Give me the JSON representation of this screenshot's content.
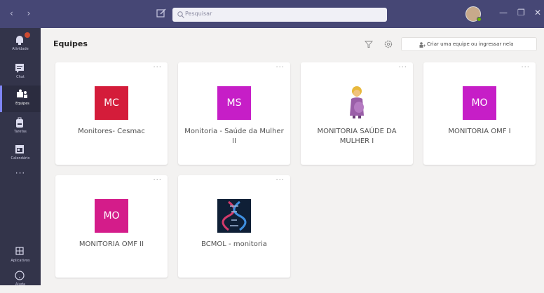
{
  "titlebar": {
    "search_placeholder": "Pesquisar",
    "nav_arrows": "‹ ›",
    "minimize": "—",
    "maximize": "❐",
    "close": "✕"
  },
  "rail": {
    "items": [
      {
        "label": "Atividade",
        "icon": "bell-icon"
      },
      {
        "label": "Chat",
        "icon": "chat-icon"
      },
      {
        "label": "Equipes",
        "icon": "teams-icon"
      },
      {
        "label": "Tarefas",
        "icon": "backpack-icon"
      },
      {
        "label": "Calendário",
        "icon": "calendar-icon"
      }
    ],
    "more": "···",
    "bottom": [
      {
        "label": "Aplicativos",
        "icon": "apps-icon"
      },
      {
        "label": "Ajuda",
        "icon": "help-icon"
      }
    ]
  },
  "header": {
    "title": "Equipes",
    "join_button": "Criar uma equipe ou ingressar nela"
  },
  "cards": [
    {
      "initials": "MC",
      "name": "Monitores- Cesmac",
      "color": "#d41c3a"
    },
    {
      "initials": "MS",
      "name": "Monitoria - Saúde da Mulher II",
      "color": "#c61ec7"
    },
    {
      "initials": "",
      "name": "MONITORIA SAÚDE DA MULHER I",
      "color": "#ffffff",
      "icon": "pregnant-woman-icon"
    },
    {
      "initials": "MO",
      "name": "MONITORIA OMF I",
      "color": "#c61ec7"
    },
    {
      "initials": "MO",
      "name": "MONITORIA OMF II",
      "color": "#d41c8a"
    },
    {
      "initials": "",
      "name": "BCMOL - monitoria",
      "color": "#0f1f36",
      "icon": "dna-icon"
    }
  ],
  "card_more": "···"
}
